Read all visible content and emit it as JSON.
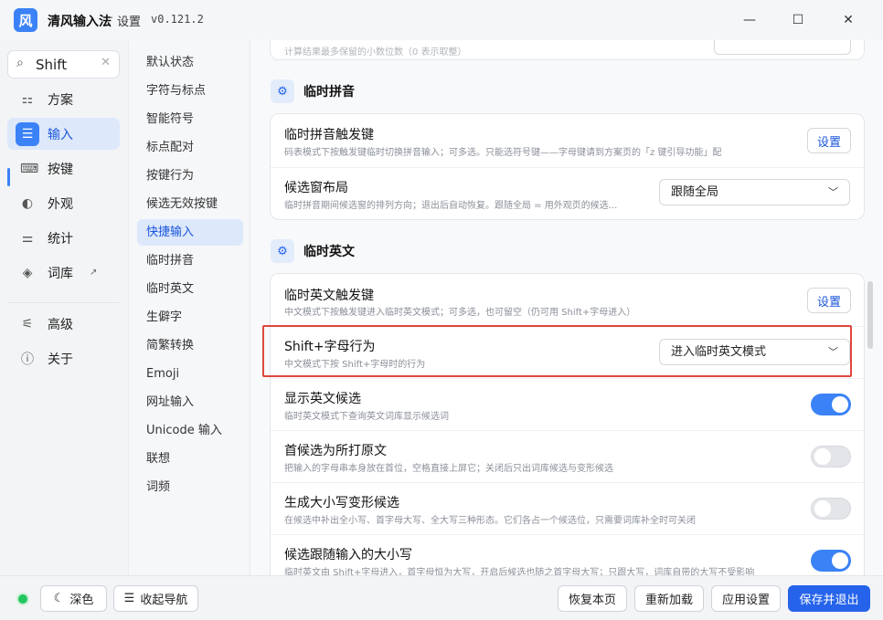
{
  "titlebar": {
    "logo_char": "风",
    "app_name": "清风输入法",
    "separator": "·",
    "page": "设置",
    "version": "v0.121.2",
    "minimize": "—",
    "maximize": "☐",
    "close": "✕"
  },
  "search": {
    "value": "Shift",
    "clear": "✕",
    "icon": "⌕"
  },
  "nav": {
    "items": [
      {
        "label": "方案",
        "icon": "⚏"
      },
      {
        "label": "输入",
        "icon": "☰"
      },
      {
        "label": "按键",
        "icon": "⌨"
      },
      {
        "label": "外观",
        "icon": "◐"
      },
      {
        "label": "统计",
        "icon": "⚌"
      },
      {
        "label": "词库",
        "icon": "◈",
        "ext": "↗"
      },
      {
        "label": "高级",
        "icon": "⚟"
      },
      {
        "label": "关于",
        "icon": "ⓘ"
      }
    ]
  },
  "subnav": {
    "items": [
      "默认状态",
      "字符与标点",
      "智能符号",
      "标点配对",
      "按键行为",
      "候选无效按键",
      "快捷输入",
      "临时拼音",
      "临时英文",
      "生僻字",
      "简繁转换",
      "Emoji",
      "网址输入",
      "Unicode 输入",
      "联想",
      "词频"
    ]
  },
  "top_card": {
    "desc": "计算结果最多保留的小数位数（0 表示取整）"
  },
  "section_pinyin": {
    "title": "临时拼音",
    "icon": "⚙",
    "rows": [
      {
        "title": "临时拼音触发键",
        "desc": "码表模式下按触发键临时切换拼音输入；可多选。只能选符号键——字母键请到方案页的「z 键引导功能」配",
        "button": "设置"
      },
      {
        "title": "候选窗布局",
        "desc": "临时拼音期间候选窗的排列方向；退出后自动恢复。跟随全局 = 用外观页的候选...",
        "select": "跟随全局"
      }
    ]
  },
  "section_english": {
    "title": "临时英文",
    "icon": "⚙",
    "rows": [
      {
        "title": "临时英文触发键",
        "desc": "中文模式下按触发键进入临时英文模式；可多选，也可留空（仍可用 Shift+字母进入）",
        "button": "设置"
      },
      {
        "title": "Shift+字母行为",
        "desc": "中文模式下按 Shift+字母时的行为",
        "select": "进入临时英文模式"
      },
      {
        "title": "显示英文候选",
        "desc": "临时英文模式下查询英文词库显示候选词",
        "toggle": true
      },
      {
        "title": "首候选为所打原文",
        "desc": "把输入的字母串本身放在首位，空格直接上屏它；关闭后只出词库候选与变形候选",
        "toggle": false
      },
      {
        "title": "生成大小写变形候选",
        "desc": "在候选中补出全小写、首字母大写、全大写三种形态。它们各占一个候选位，只需要词库补全时可关闭",
        "toggle": false
      },
      {
        "title": "候选跟随输入的大小写",
        "desc": "临时英文由 Shift+字母进入，首字母恒为大写，开启后候选也随之首字母大写；只跟大写，词库自带的大写不受影响",
        "toggle": true
      }
    ]
  },
  "bottom": {
    "dark_icon": "☾",
    "dark_label": "深色",
    "collapse_icon": "☰",
    "collapse_label": "收起导航",
    "restore": "恢复本页",
    "reload": "重新加载",
    "apply": "应用设置",
    "save_exit": "保存并退出"
  },
  "colors": {
    "accent": "#3b82f6",
    "highlight": "#e0463c",
    "status": "#22c55e"
  }
}
